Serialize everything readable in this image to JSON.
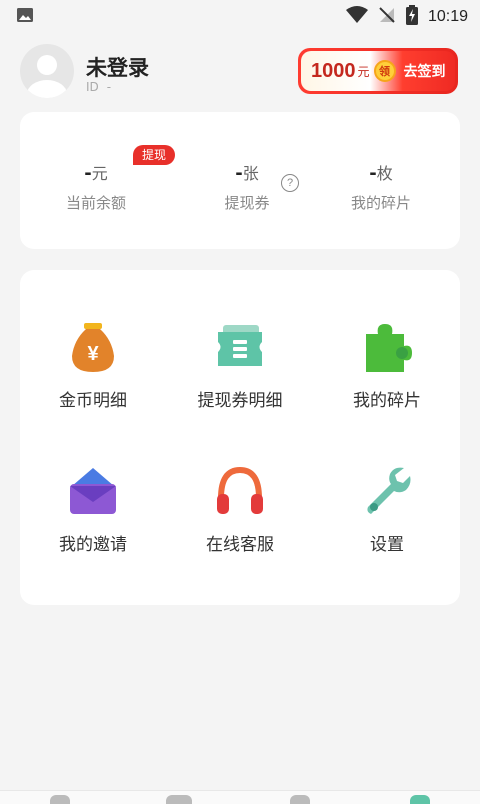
{
  "status_bar": {
    "time": "10:19",
    "icons": [
      "image-icon",
      "wifi-icon",
      "no-signal-icon",
      "battery-charging-icon"
    ]
  },
  "profile": {
    "username": "未登录",
    "id_label": "ID",
    "id_value": "-",
    "signin": {
      "amount": "1000",
      "unit": "元",
      "coin_text": "领",
      "action": "去签到"
    }
  },
  "balance": {
    "withdraw_badge": "提现",
    "items": [
      {
        "value": "-",
        "unit": "元",
        "label": "当前余额"
      },
      {
        "value": "-",
        "unit": "张",
        "label": "提现券"
      },
      {
        "value": "-",
        "unit": "枚",
        "label": "我的碎片"
      }
    ],
    "help_icon_text": "?"
  },
  "menu": {
    "items": [
      {
        "label": "金币明细",
        "icon": "money-bag-icon"
      },
      {
        "label": "提现券明细",
        "icon": "ticket-icon"
      },
      {
        "label": "我的碎片",
        "icon": "puzzle-icon"
      },
      {
        "label": "我的邀请",
        "icon": "envelope-icon"
      },
      {
        "label": "在线客服",
        "icon": "headphones-icon"
      },
      {
        "label": "设置",
        "icon": "wrench-icon"
      }
    ]
  },
  "colors": {
    "accent_red": "#e8302a",
    "background": "#f4f4f4",
    "card": "#ffffff"
  }
}
